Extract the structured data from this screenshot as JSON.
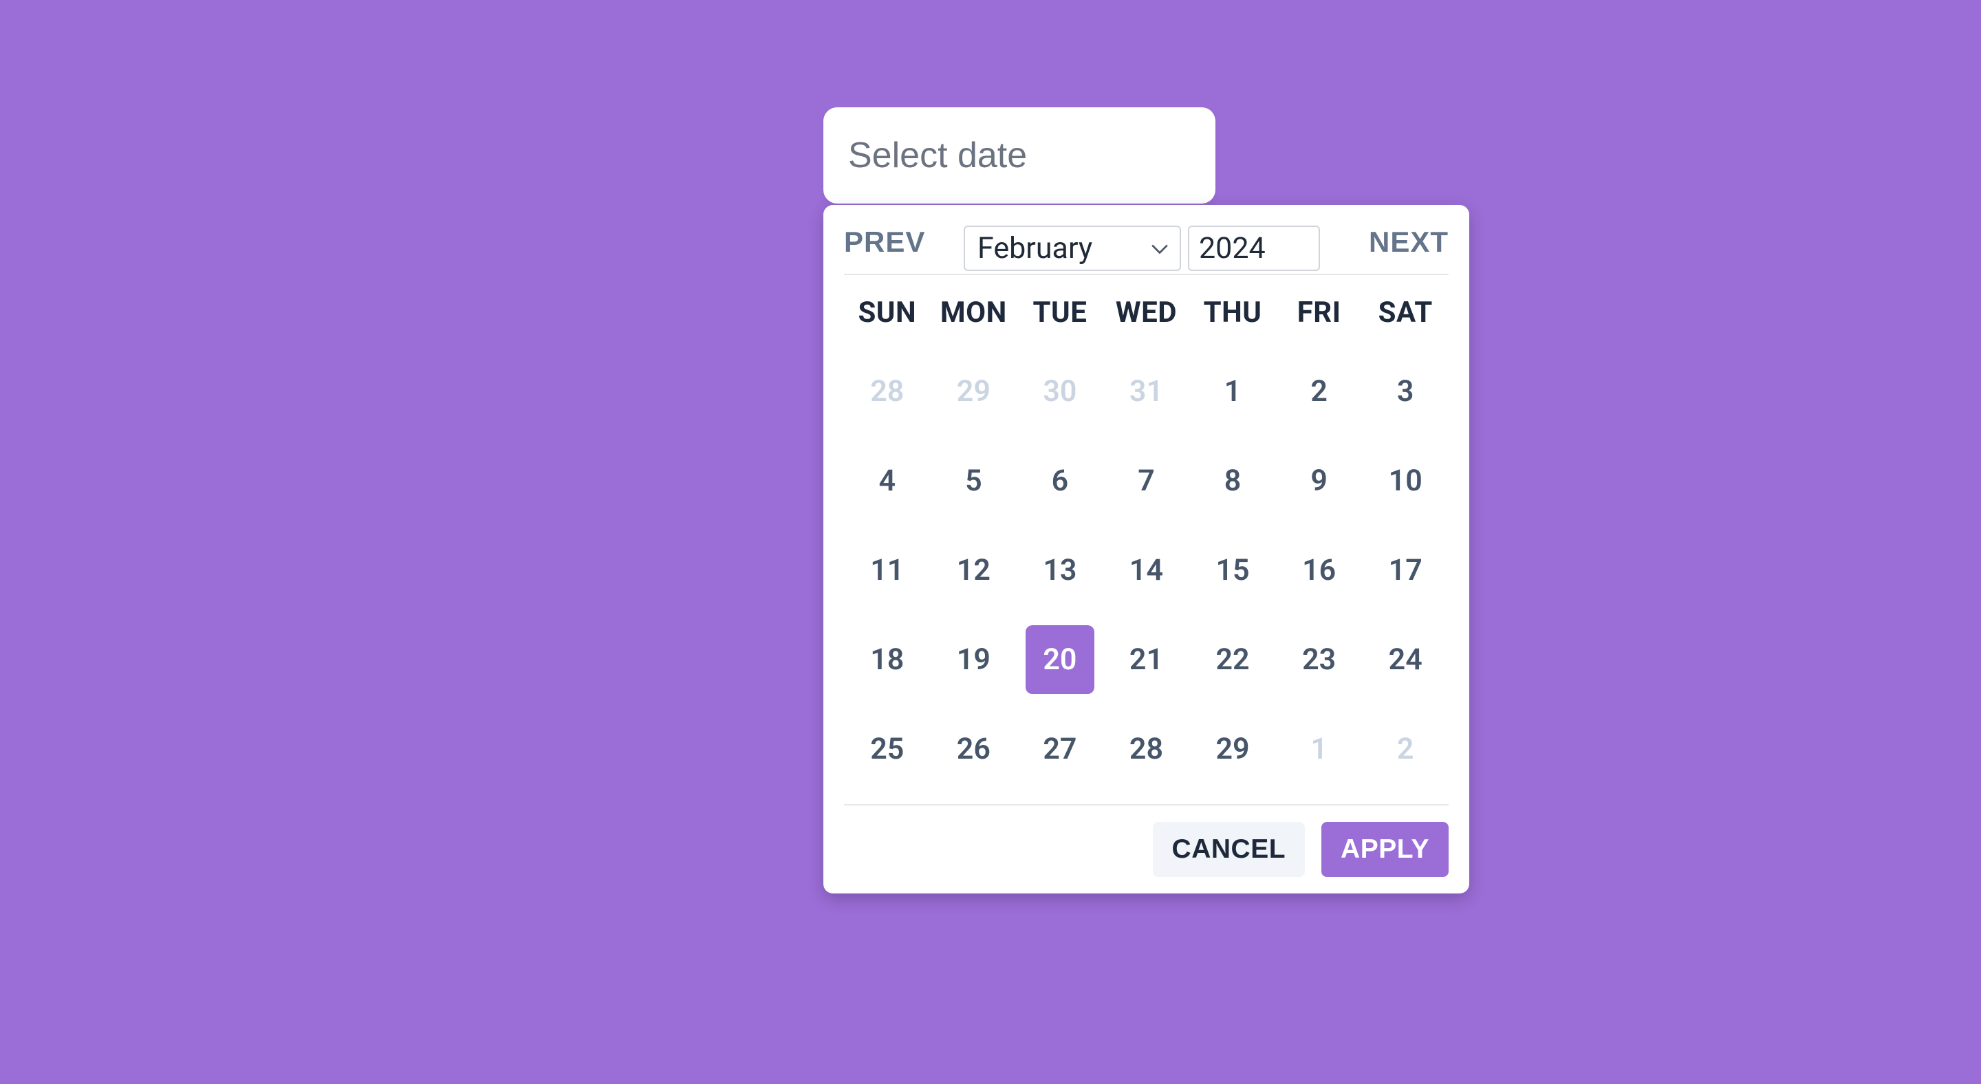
{
  "input": {
    "placeholder": "Select date",
    "value": ""
  },
  "nav": {
    "prev": "PREV",
    "next": "NEXT",
    "month": "February",
    "year": "2024"
  },
  "weekdays": [
    "SUN",
    "MON",
    "TUE",
    "WED",
    "THU",
    "FRI",
    "SAT"
  ],
  "days": [
    {
      "n": "28",
      "muted": true
    },
    {
      "n": "29",
      "muted": true
    },
    {
      "n": "30",
      "muted": true
    },
    {
      "n": "31",
      "muted": true
    },
    {
      "n": "1"
    },
    {
      "n": "2"
    },
    {
      "n": "3"
    },
    {
      "n": "4"
    },
    {
      "n": "5"
    },
    {
      "n": "6"
    },
    {
      "n": "7"
    },
    {
      "n": "8"
    },
    {
      "n": "9"
    },
    {
      "n": "10"
    },
    {
      "n": "11"
    },
    {
      "n": "12"
    },
    {
      "n": "13"
    },
    {
      "n": "14"
    },
    {
      "n": "15"
    },
    {
      "n": "16"
    },
    {
      "n": "17"
    },
    {
      "n": "18"
    },
    {
      "n": "19"
    },
    {
      "n": "20",
      "selected": true
    },
    {
      "n": "21"
    },
    {
      "n": "22"
    },
    {
      "n": "23"
    },
    {
      "n": "24"
    },
    {
      "n": "25"
    },
    {
      "n": "26"
    },
    {
      "n": "27"
    },
    {
      "n": "28"
    },
    {
      "n": "29"
    },
    {
      "n": "1",
      "muted": true
    },
    {
      "n": "2",
      "muted": true
    }
  ],
  "footer": {
    "cancel": "CANCEL",
    "apply": "APPLY"
  },
  "colors": {
    "accent": "#9B6DD7"
  }
}
